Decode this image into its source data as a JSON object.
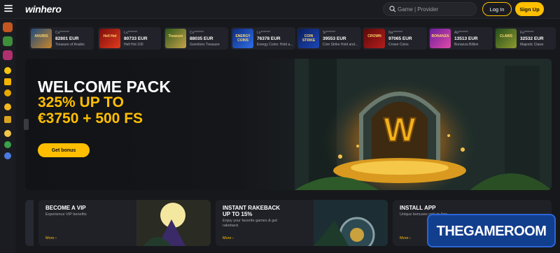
{
  "header": {
    "logo_text": "winhero",
    "search_placeholder": "Game | Provider",
    "login_label": "Log In",
    "signup_label": "Sign Up"
  },
  "recent_wins": [
    {
      "user": "Ca*******",
      "amount": "82801 EUR",
      "game": "Treasure of Anubis",
      "thumb": "ANUBIS"
    },
    {
      "user": "Lu*******",
      "amount": "80733 EUR",
      "game": "Hell Hot 100",
      "thumb": "Hell Hot"
    },
    {
      "user": "Co*******",
      "amount": "88035 EUR",
      "game": "Gonnitors Treasure",
      "thumb": "Treasure"
    },
    {
      "user": "Lo*******",
      "amount": "76378 EUR",
      "game": "Energy Coins: Hold a...",
      "thumb": "ENERGY COINS"
    },
    {
      "user": "Si*******",
      "amount": "39553 EUR",
      "game": "Coin Strike Hold and...",
      "thumb": "COIN STRIKE"
    },
    {
      "user": "Na*******",
      "amount": "97065 EUR",
      "game": "Crown Coins",
      "thumb": "CROWN"
    },
    {
      "user": "Ab*******",
      "amount": "13513 EUR",
      "game": "Bonanza Billion",
      "thumb": "BONANZA"
    },
    {
      "user": "Fa*******",
      "amount": "32532 EUR",
      "game": "Majestic Claws",
      "thumb": "CLAWS"
    }
  ],
  "hero": {
    "line1": "WELCOME PACK",
    "line2": "325% UP TO",
    "line3": "€3750 + 500 FS",
    "cta": "Get bonus"
  },
  "promos": [
    {
      "title": "BECOME A VIP",
      "desc": "Experience VIP benefits",
      "more": "More ›"
    },
    {
      "title": "INSTANT RAKEBACK\nUP TO 15%",
      "desc": "Enjoy your favorite games & get rakeback",
      "more": "More ›"
    },
    {
      "title": "INSTALL APP",
      "desc": "Unique bonuses only in App",
      "more": "More ›"
    }
  ],
  "watermark": "THEGAMEROOM",
  "colors": {
    "accent": "#ffbf00",
    "background": "#17181c",
    "panel": "#22232a"
  }
}
